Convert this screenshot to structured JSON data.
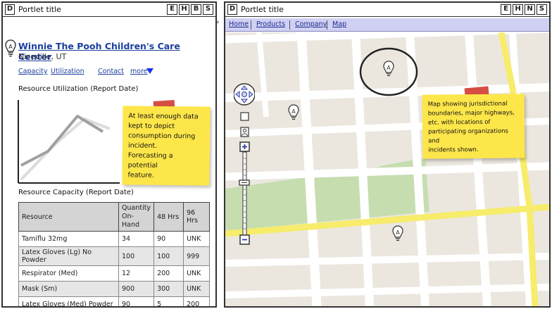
{
  "left_portlet": {
    "icon": "D",
    "title": "Portlet title",
    "buttons": [
      "E",
      "H",
      "B",
      "S"
    ],
    "org": {
      "name": "Winnie The Pooh Children's Care Center",
      "location": "Niceville, UT"
    },
    "links": {
      "capacity": "Capacity",
      "utilization": "Utilization",
      "contact": "Contact",
      "more": "more"
    },
    "utilization_title": "Resource Utilization (Report Date)",
    "note": {
      "line1": "At least enough data",
      "line2": "kept to depict",
      "line3": "consumption during",
      "line4": "incident.",
      "line5": "Forecasting a potential",
      "line6": "feature."
    },
    "capacity_title": "Resource Capacity (Report Date)",
    "table": {
      "headers": {
        "resource": "Resource",
        "qty_line1": "Quantity",
        "qty_line2": "On-Hand",
        "h48": "48 Hrs",
        "h96": "96 Hrs"
      },
      "rows": [
        {
          "resource": "Tamiflu 32mg",
          "qty": "34",
          "h48": "90",
          "h96": "UNK"
        },
        {
          "resource": "Latex Gloves (Lg) No Powder",
          "qty": "100",
          "h48": "100",
          "h96": "999"
        },
        {
          "resource": "Respirator (Med)",
          "qty": "12",
          "h48": "200",
          "h96": "UNK"
        },
        {
          "resource": "Mask (Sm)",
          "qty": "900",
          "h48": "300",
          "h96": "UNK"
        },
        {
          "resource": "Latex Gloves (Med) Powder",
          "qty": "90",
          "h48": "5",
          "h96": "200"
        }
      ]
    }
  },
  "right_portlet": {
    "icon": "D",
    "title": "Portlet title",
    "buttons": [
      "E",
      "H",
      "N",
      "S"
    ],
    "collapse_arrow": "«",
    "tabs": {
      "home": "Home",
      "products": "Products",
      "company": "Company",
      "map": "Map"
    },
    "map_note": {
      "line1": "Map showing jurisdictional",
      "line2": "boundaries, major highways,",
      "line3": "etc. with locations of",
      "line4": "participating organizations and",
      "line5": "incidents shown."
    }
  },
  "colors": {
    "link": "#1a3f9e",
    "sticky": "#fde64a",
    "tape": "#d23a2f",
    "tabbar": "#d0d0f4",
    "map_bg": "#ebe7df",
    "road_major": "#f7ec6b",
    "park": "#c6ddb0"
  },
  "icons": [
    "lightbulb-icon",
    "more-arrow-icon",
    "pan-control-icon",
    "zoom-in-icon",
    "zoom-out-icon",
    "street-view-icon",
    "map-marker-icon"
  ]
}
